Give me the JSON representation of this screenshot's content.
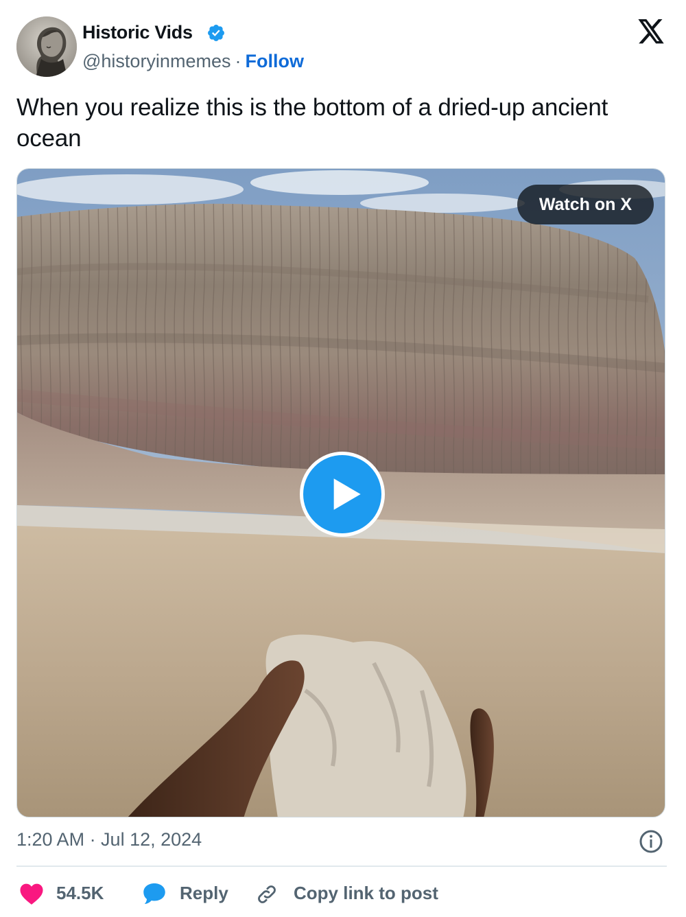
{
  "author": {
    "name": "Historic Vids",
    "handle": "@historyinmemes",
    "separator": "·",
    "follow_label": "Follow",
    "verified_color": "#1d9bf0"
  },
  "post": {
    "text": "When you realize this is the bottom of a dried-up ancient ocean"
  },
  "media": {
    "watch_label": "Watch on X",
    "play_icon": "play-icon"
  },
  "meta": {
    "timestamp": "1:20 AM · Jul 12, 2024"
  },
  "actions": {
    "likes": "54.5K",
    "reply_label": "Reply",
    "copy_label": "Copy link to post"
  },
  "colors": {
    "accent": "#1d9bf0",
    "like": "#f91880",
    "link": "#0f6bd8",
    "muted": "#536471"
  }
}
